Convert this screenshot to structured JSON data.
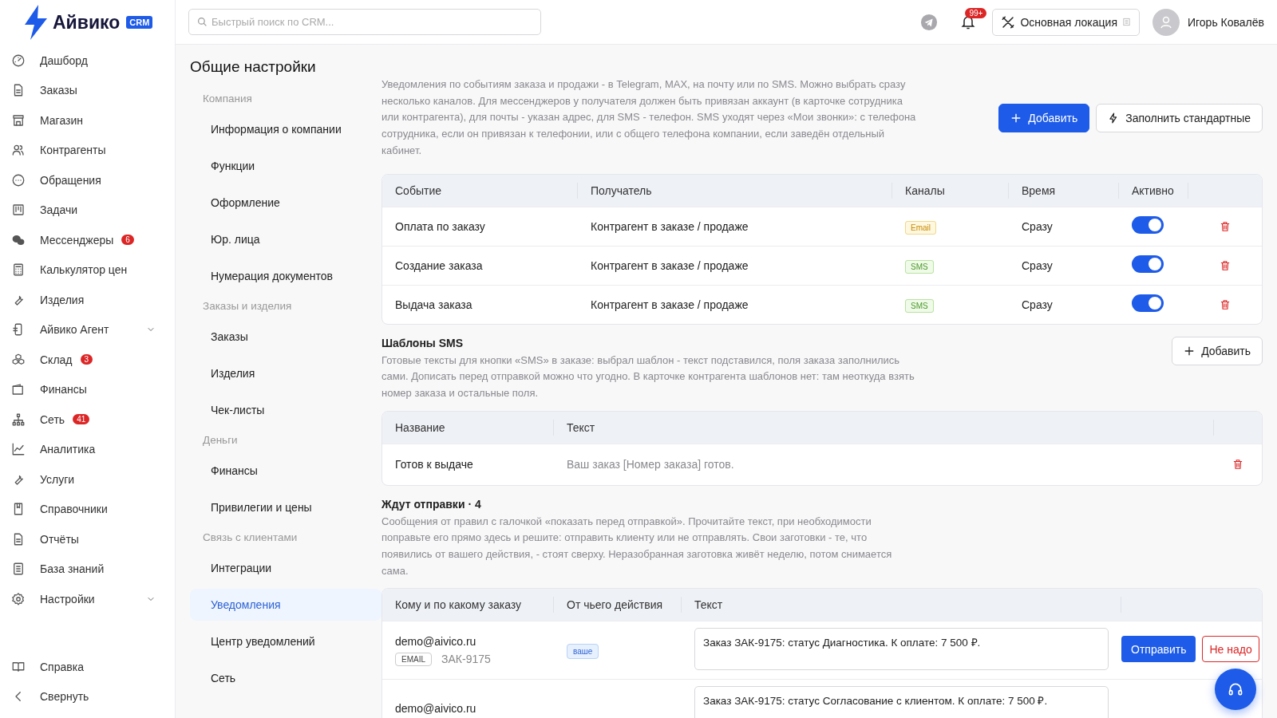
{
  "brand": {
    "name": "Айвико",
    "tag": "CRM"
  },
  "sidebar": {
    "items": [
      {
        "label": "Дашборд"
      },
      {
        "label": "Заказы"
      },
      {
        "label": "Магазин"
      },
      {
        "label": "Контрагенты"
      },
      {
        "label": "Обращения"
      },
      {
        "label": "Задачи"
      },
      {
        "label": "Мессенджеры",
        "badge": "6"
      },
      {
        "label": "Калькулятор цен"
      },
      {
        "label": "Изделия"
      },
      {
        "label": "Айвико Агент",
        "submenu": true
      },
      {
        "label": "Склад",
        "badge": "3"
      },
      {
        "label": "Финансы"
      },
      {
        "label": "Сеть",
        "badge": "41"
      },
      {
        "label": "Аналитика"
      },
      {
        "label": "Услуги"
      },
      {
        "label": "Справочники"
      },
      {
        "label": "Отчёты"
      },
      {
        "label": "База знаний"
      },
      {
        "label": "Настройки",
        "submenu": true
      }
    ],
    "footer": [
      {
        "label": "Справка"
      },
      {
        "label": "Свернуть"
      }
    ]
  },
  "topbar": {
    "search": {
      "placeholder": "Быстрый поиск по CRM..."
    },
    "notifications_badge": "99+",
    "location": "Основная локация",
    "user": "Игорь Ковалёв"
  },
  "settings_nav": {
    "title": "Общие настройки",
    "groups": [
      {
        "heading": "Компания",
        "items": [
          {
            "label": "Информация о компании",
            "selected": false
          },
          {
            "label": "Функции",
            "selected": false
          },
          {
            "label": "Оформление",
            "selected": false
          },
          {
            "label": "Юр. лица",
            "selected": false
          },
          {
            "label": "Нумерация документов",
            "selected": false
          }
        ]
      },
      {
        "heading": "Заказы и изделия",
        "items": [
          {
            "label": "Заказы",
            "selected": false
          },
          {
            "label": "Изделия",
            "selected": false
          },
          {
            "label": "Чек-листы",
            "selected": false
          }
        ]
      },
      {
        "heading": "Деньги",
        "items": [
          {
            "label": "Финансы",
            "selected": false
          },
          {
            "label": "Привилегии и цены",
            "selected": false
          }
        ]
      },
      {
        "heading": "Связь с клиентами",
        "items": [
          {
            "label": "Интеграции",
            "selected": false
          },
          {
            "label": "Уведомления",
            "selected": true
          },
          {
            "label": "Центр уведомлений",
            "selected": false
          },
          {
            "label": "Сеть",
            "selected": false
          }
        ]
      }
    ]
  },
  "notifications": {
    "description": "Уведомления по событиям заказа и продажи - в Telegram, MAX, на почту или по SMS. Можно выбрать сразу несколько каналов. Для мессенджеров у получателя должен быть привязан аккаунт (в карточке сотрудника или контрагента), для почты - указан адрес, для SMS - телефон. SMS уходят через «Мои звонки»: с телефона сотрудника, если он привязан к телефонии, или с общего телефона компании, если заведён отдельный кабинет.",
    "buttons": [
      {
        "label": "Добавить",
        "kind": "primary"
      },
      {
        "label": "Заполнить стандартные",
        "kind": "fill"
      }
    ],
    "table": {
      "columns": [
        "Событие",
        "Получатель",
        "Каналы",
        "Время",
        "Активно"
      ],
      "rows": [
        {
          "event": "Оплата по заказу",
          "recipient": "Контрагент в заказе / продаже",
          "channel": {
            "label": "Email",
            "kind": "email"
          },
          "time": "Сразу",
          "active": true
        },
        {
          "event": "Создание заказа",
          "recipient": "Контрагент в заказе / продаже",
          "channel": {
            "label": "SMS",
            "kind": "sms"
          },
          "time": "Сразу",
          "active": true
        },
        {
          "event": "Выдача заказа",
          "recipient": "Контрагент в заказе / продаже",
          "channel": {
            "label": "SMS",
            "kind": "sms"
          },
          "time": "Сразу",
          "active": true
        }
      ]
    }
  },
  "sms_templates": {
    "title": "Шаблоны SMS",
    "description": "Готовые тексты для кнопки «SMS» в заказе: выбрал шаблон - текст подставился, поля заказа заполнились сами. Дописать перед отправкой можно что угодно. В карточке контрагента шаблонов нет: там неоткуда взять номер заказа и остальные поля.",
    "add_button": "Добавить",
    "table": {
      "columns": [
        "Название",
        "Текст"
      ],
      "rows": [
        {
          "name": "Готов к выдаче",
          "text": "Ваш заказ [Номер заказа] готов."
        }
      ]
    }
  },
  "pending": {
    "title": "Ждут отправки · 4",
    "description": "Сообщения от правил с галочкой «показать перед отправкой». Прочитайте текст, при необходимости поправьте его прямо здесь и решите: отправить клиенту или не отправлять. Свои заготовки - те, что появились от вашего действия, - стоят сверху. Неразобранная заготовка живёт неделю, потом снимается сама.",
    "table": {
      "columns": [
        "Кому и по какому заказу",
        "От чьего действия",
        "Текст"
      ],
      "rows": [
        {
          "recipient": "demo@aivico.ru",
          "channel": "EMAIL",
          "order": "ЗАК-9175",
          "source": "ваше",
          "text": "Заказ ЗАК-9175: статус Диагностика. К оплате: 7 500 ₽.",
          "send": "Отправить",
          "dismiss": "Не надо"
        },
        {
          "recipient": "demo@aivico.ru",
          "text": "Заказ ЗАК-9175: статус Согласование с клиентом. К оплате: 7 500 ₽."
        }
      ]
    }
  }
}
